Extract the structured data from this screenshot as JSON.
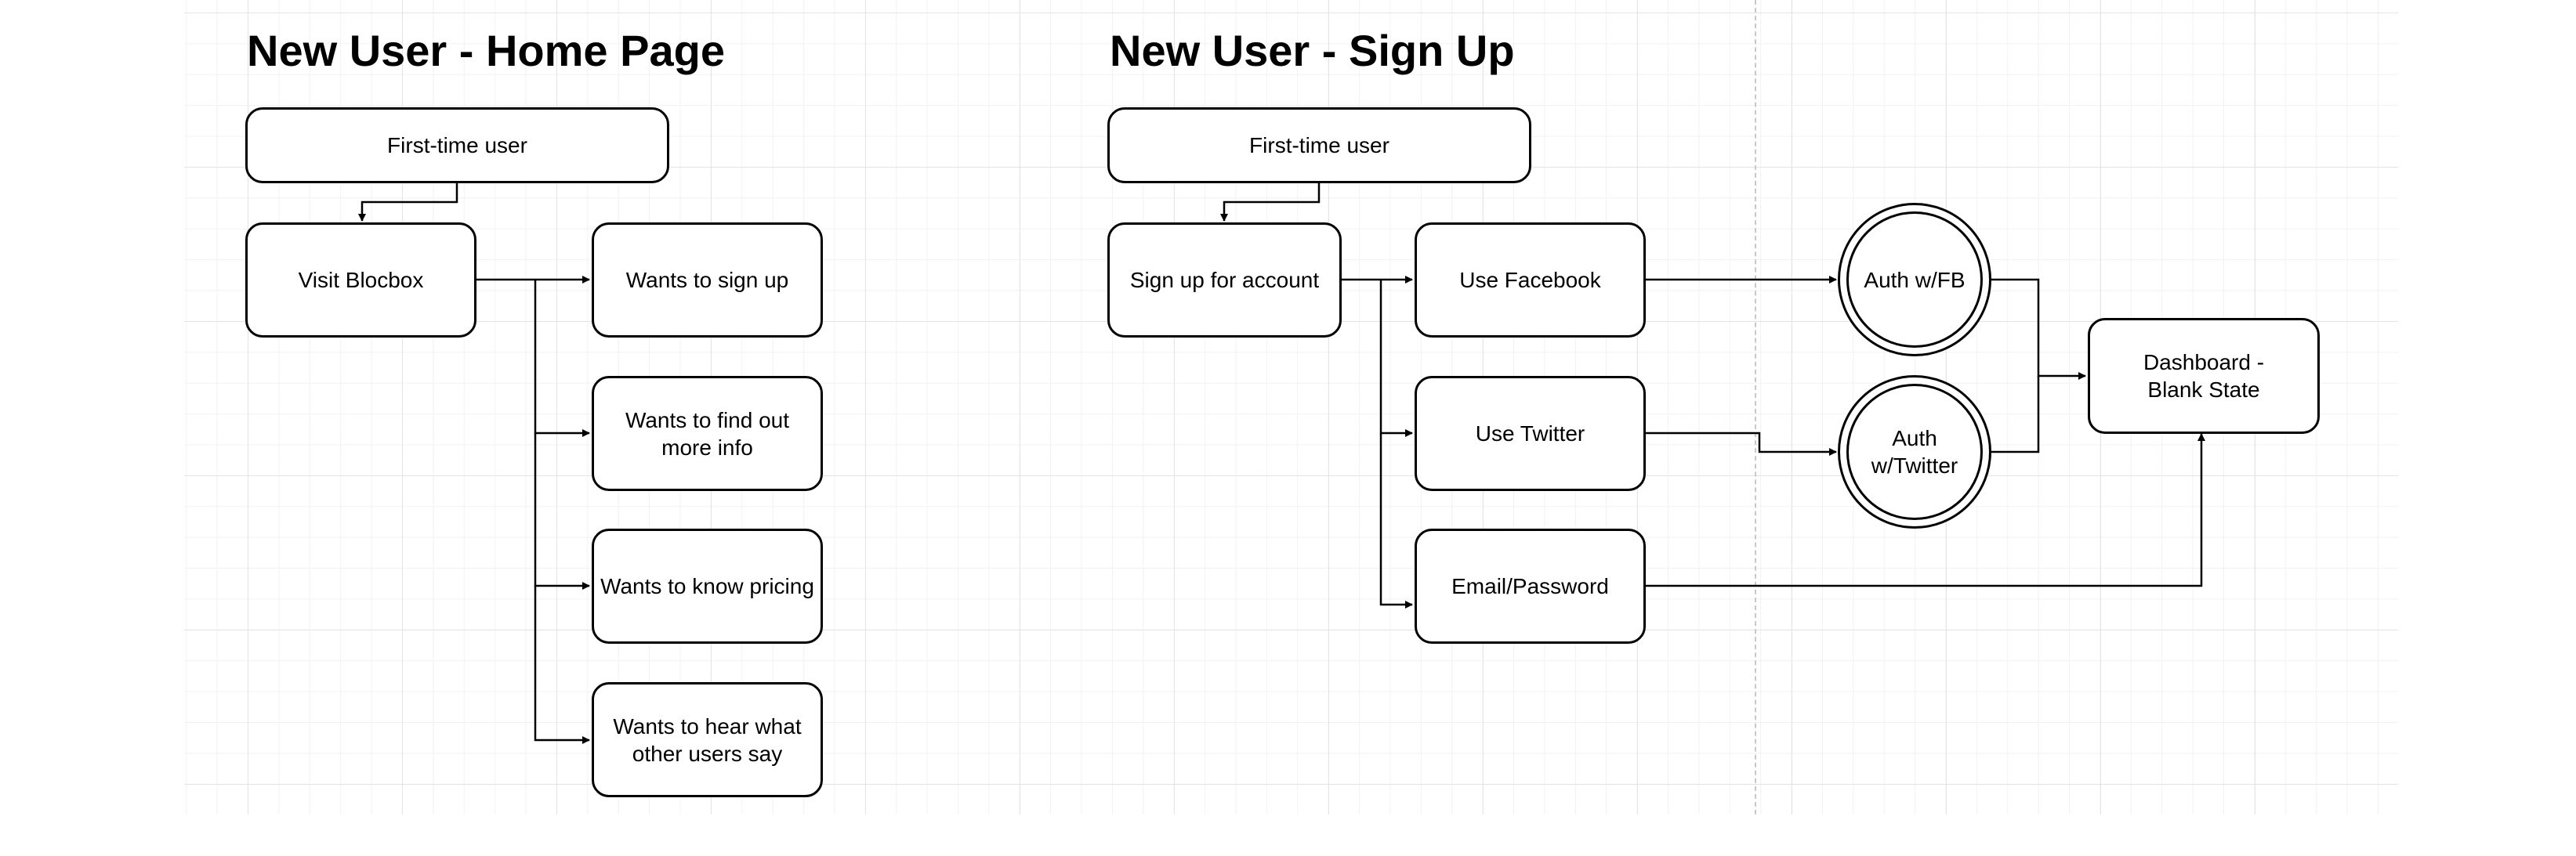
{
  "home_page": {
    "title": "New User - Home Page",
    "first_time_user": "First-time user",
    "visit_blocbox": "Visit Blocbox",
    "wants_sign_up": "Wants to sign up",
    "wants_more_info": "Wants to find out more info",
    "wants_pricing": "Wants to know pricing",
    "wants_hear_users": "Wants to hear what other users say"
  },
  "sign_up": {
    "title": "New User - Sign Up",
    "first_time_user": "First-time user",
    "sign_up_account": "Sign up for account",
    "use_facebook": "Use Facebook",
    "use_twitter": "Use Twitter",
    "email_password": "Email/Password",
    "auth_fb": "Auth w/FB",
    "auth_twitter": "Auth w/Twitter",
    "dashboard": "Dashboard - Blank State"
  },
  "colors": {
    "stroke": "#000000",
    "grid": "#e4e4e4",
    "background": "#ffffff"
  }
}
